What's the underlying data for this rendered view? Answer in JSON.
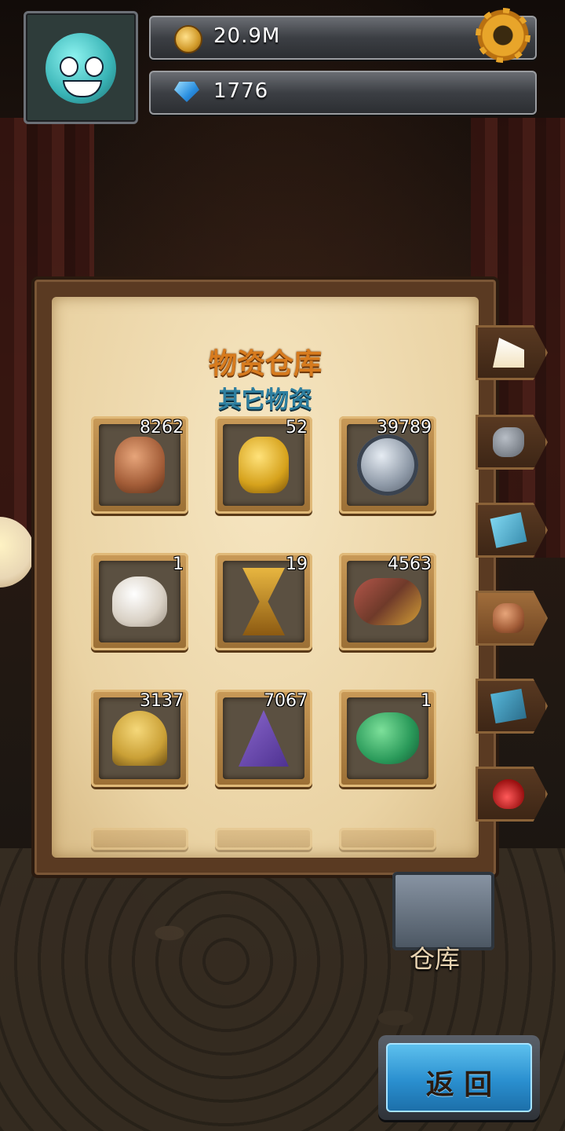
{
  "hud": {
    "coins": "20.9M",
    "gems": "1776",
    "icons": {
      "coin": "coin-icon",
      "gem": "gem-icon",
      "settings": "gear-icon"
    }
  },
  "panel": {
    "title": "物资仓库",
    "subtitle": "其它物资",
    "items": [
      {
        "name": "bronze-vase",
        "count": "8262"
      },
      {
        "name": "gold-vase",
        "count": "52"
      },
      {
        "name": "silver-helmet-medal",
        "count": "39789"
      },
      {
        "name": "skull-crystal",
        "count": "1"
      },
      {
        "name": "golden-hourglass",
        "count": "19"
      },
      {
        "name": "explorer-gear",
        "count": "4563"
      },
      {
        "name": "knight-helmet",
        "count": "3137"
      },
      {
        "name": "wizard-hat-book",
        "count": "7067"
      },
      {
        "name": "green-slime",
        "count": "1"
      }
    ]
  },
  "tabs": [
    {
      "icon": "cake-icon",
      "active": false
    },
    {
      "icon": "rock-icon",
      "active": false
    },
    {
      "icon": "box-icon",
      "active": false
    },
    {
      "icon": "vase-icon",
      "active": true
    },
    {
      "icon": "book-icon",
      "active": false
    },
    {
      "icon": "potion-icon",
      "active": false
    }
  ],
  "scene": {
    "warehouse_label": "仓库"
  },
  "back_button": {
    "label": "返 回"
  }
}
